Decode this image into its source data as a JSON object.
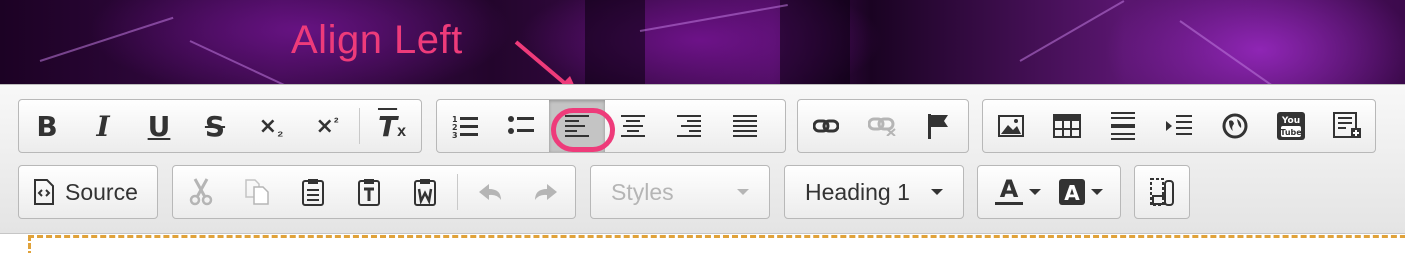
{
  "annotation": {
    "text": "Align Left",
    "color": "#ee3b7a"
  },
  "toolbar": {
    "row1": {
      "basic_styles": [
        "bold-button",
        "italic-button",
        "underline-button",
        "strikethrough-button",
        "subscript-button",
        "superscript-button",
        "remove-format-button"
      ],
      "paragraph": [
        "numbered-list-button",
        "bulleted-list-button",
        "align-left-button",
        "align-center-button",
        "align-right-button",
        "justify-button"
      ],
      "links": [
        "link-button",
        "unlink-button",
        "anchor-button"
      ],
      "insert": [
        "image-button",
        "table-button",
        "horizontal-line-button",
        "indent-button",
        "iframe-button",
        "youtube-button",
        "template-button"
      ]
    },
    "row2": {
      "source_label": "Source",
      "clipboard": [
        "cut-button",
        "copy-button",
        "paste-button",
        "paste-text-button",
        "paste-word-button"
      ],
      "undo_redo": [
        "undo-button",
        "redo-button"
      ],
      "styles": {
        "value": "Styles",
        "disabled": true
      },
      "format": {
        "value": "Heading 1"
      },
      "colors": [
        "text-color-button",
        "background-color-button"
      ],
      "extra": [
        "show-blocks-button"
      ]
    },
    "active_button": "align-left-button",
    "youtube_icon_text": [
      "You",
      "Tube"
    ]
  },
  "colors": {
    "accent": "#ee3b7a",
    "editor_border": "#e0a23a"
  }
}
